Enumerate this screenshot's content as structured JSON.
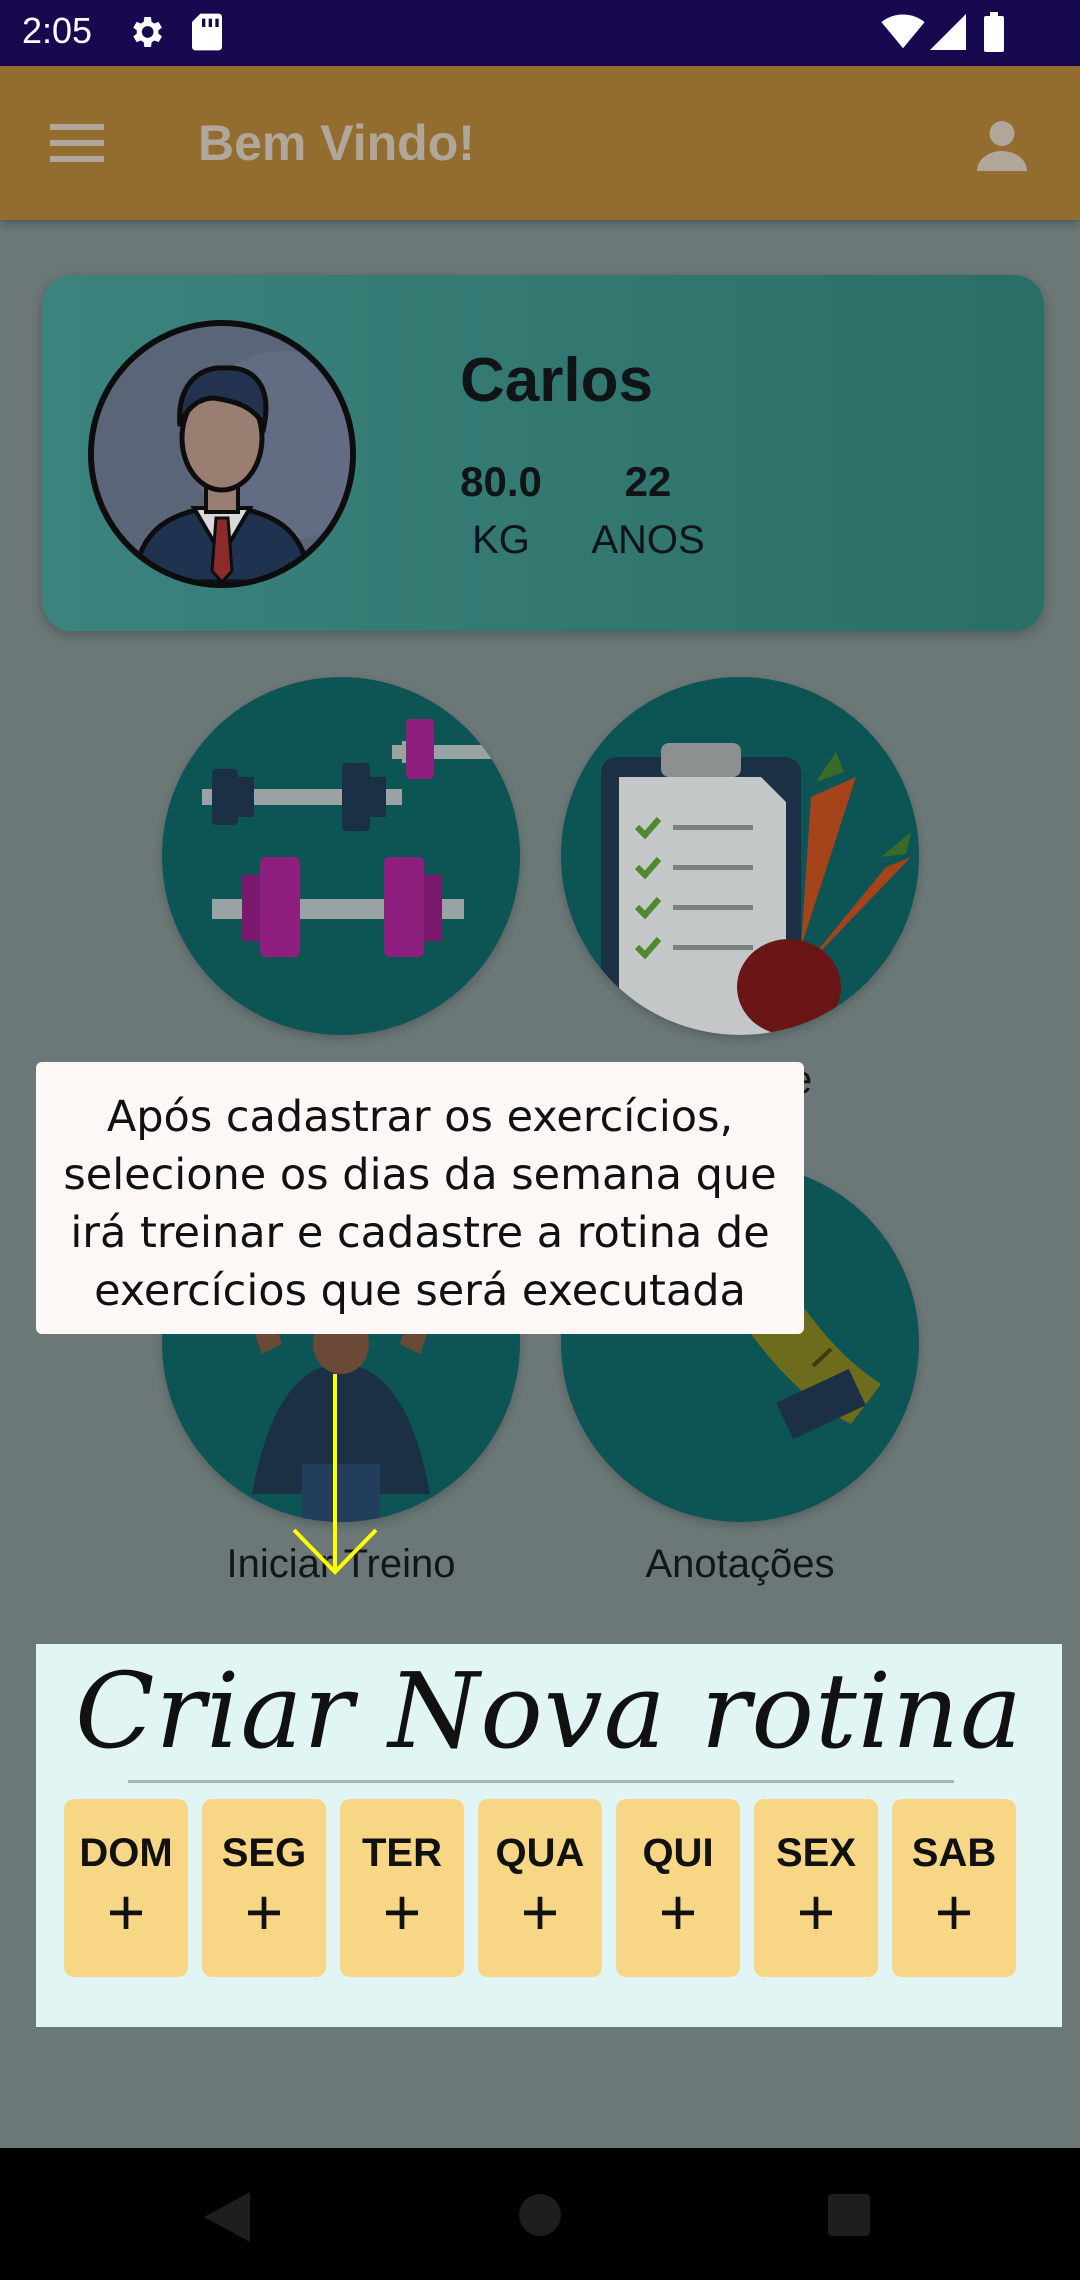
{
  "status_bar": {
    "time": "2:05",
    "icons": [
      "gear-icon",
      "sd-card-icon",
      "wifi-icon",
      "signal-icon",
      "battery-icon"
    ]
  },
  "app_bar": {
    "title": "Bem Vindo!",
    "menu_icon": "menu-icon",
    "profile_icon": "person-icon"
  },
  "profile": {
    "name": "Carlos",
    "weight": "80.0",
    "weight_unit": "KG",
    "age": "22",
    "age_unit": "ANOS"
  },
  "features": [
    {
      "icon": "dumbbell-icon",
      "label": ""
    },
    {
      "icon": "diet-clipboard-icon",
      "label": "e"
    },
    {
      "icon": "workout-man-icon",
      "label": "Iniciar Treino"
    },
    {
      "icon": "measuring-tape-icon",
      "label": "Anotações"
    }
  ],
  "tooltip": {
    "text": "Após cadastrar os exercícios, selecione os dias da semana que irá treinar e cadastre a rotina de exercícios que será executada"
  },
  "routine": {
    "title": "Criar Nova rotina",
    "plus": "+",
    "days": [
      "DOM",
      "SEG",
      "TER",
      "QUA",
      "QUI",
      "SEX",
      "SAB"
    ]
  },
  "colors": {
    "status_bar": "#17084f",
    "app_bar": "#926d2f",
    "card": "#2f7a74",
    "circle": "#0d5455",
    "day_button": "#f7d785",
    "routine_panel": "#e0f5f4",
    "arrow": "#ffff00"
  }
}
